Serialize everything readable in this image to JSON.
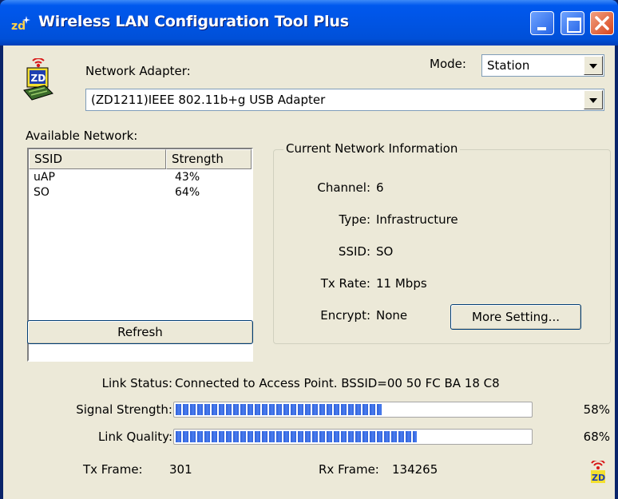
{
  "window": {
    "title": "Wireless LAN Configuration Tool Plus"
  },
  "adapter": {
    "label": "Network Adapter:",
    "value": "(ZD1211)IEEE 802.11b+g USB Adapter"
  },
  "mode": {
    "label": "Mode:",
    "value": "Station"
  },
  "networks": {
    "label": "Available Network:",
    "columns": [
      "SSID",
      "Strength"
    ],
    "rows": [
      {
        "ssid": "uAP",
        "strength": "43%"
      },
      {
        "ssid": "SO",
        "strength": "64%"
      }
    ],
    "refresh_label": "Refresh"
  },
  "current": {
    "title": "Current Network Information",
    "channel_label": "Channel:",
    "channel": "6",
    "type_label": "Type:",
    "type": "Infrastructure",
    "ssid_label": "SSID:",
    "ssid": "SO",
    "txrate_label": "Tx Rate:",
    "txrate": "11 Mbps",
    "encrypt_label": "Encrypt:",
    "encrypt": "None",
    "more_label": "More Setting..."
  },
  "status": {
    "link_label": "Link Status:",
    "link": "Connected to Access Point. BSSID=00 50 FC BA 18 C8",
    "signal_label": "Signal Strength:",
    "signal_text": "58%",
    "signal_value": 0.58,
    "quality_label": "Link Quality:",
    "quality_text": "68%",
    "quality_value": 0.68,
    "txframe_label": "Tx Frame:",
    "txframe": "301",
    "rxframe_label": "Rx Frame:",
    "rxframe": "134265"
  },
  "colors": {
    "titlebar": "#0054e3",
    "dialog": "#ece9d8",
    "progress": "#2f5fd8"
  },
  "icons": [
    "zd-logo-icon",
    "adapter-icon",
    "minimize-icon",
    "maximize-icon",
    "close-icon",
    "tray-zd-icon"
  ]
}
